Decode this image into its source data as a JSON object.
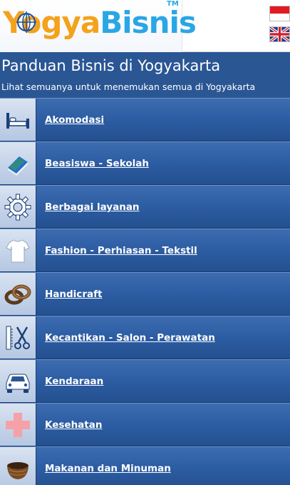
{
  "header": {
    "logo_part1": "Yogya",
    "logo_part2": "Bisnis",
    "logo_tm": "TM",
    "flag_indonesia_icon": "indonesia-flag-icon",
    "flag_uk_icon": "uk-flag-icon"
  },
  "page": {
    "title": "Panduan Bisnis di Yogyakarta",
    "subtitle": "Lihat semuanya untuk menemukan semua di Yogyakarta"
  },
  "categories": [
    {
      "label": "Akomodasi",
      "icon": "bed-icon"
    },
    {
      "label": "Beasiswa - Sekolah",
      "icon": "book-icon"
    },
    {
      "label": "Berbagai layanan",
      "icon": "gear-icon"
    },
    {
      "label": "Fashion - Perhiasan - Tekstil",
      "icon": "tshirt-icon"
    },
    {
      "label": "Handicraft",
      "icon": "bracelet-icon"
    },
    {
      "label": "Kecantikan - Salon - Perawatan",
      "icon": "scissors-comb-icon"
    },
    {
      "label": "Kendaraan",
      "icon": "car-icon"
    },
    {
      "label": "Kesehatan",
      "icon": "medical-cross-icon"
    },
    {
      "label": "Makanan dan Minuman",
      "icon": "bowl-icon"
    }
  ],
  "colors": {
    "background": "#2a5694",
    "logo_orange": "#f4a21c",
    "logo_blue": "#2aa6e6",
    "item_text": "#ffffff"
  }
}
